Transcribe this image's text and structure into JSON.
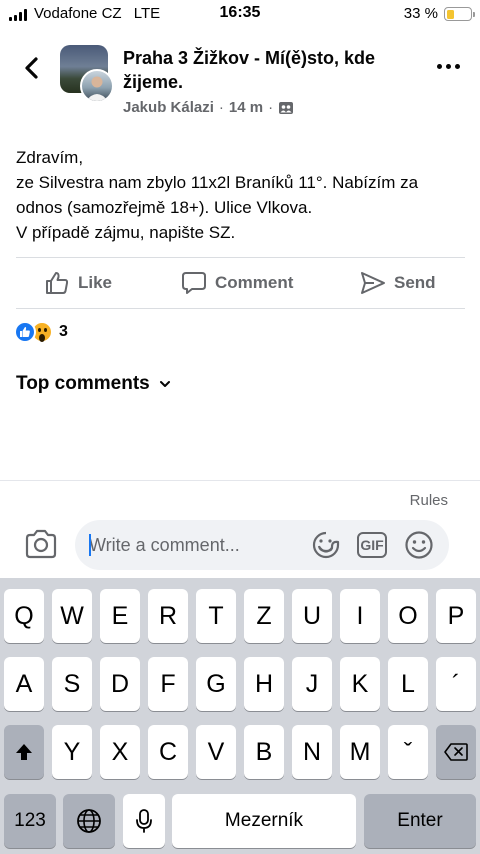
{
  "status_bar": {
    "carrier": "Vodafone CZ",
    "network": "LTE",
    "time": "16:35",
    "battery_percent": "33 %",
    "battery_level": 0.33,
    "battery_color": "#f4c430"
  },
  "header": {
    "back_icon": "chevron-left-icon",
    "group_name": "Praha 3 Žižkov - Mí(ě)sto, kde žijeme.",
    "author": "Jakub Kálazi",
    "separator": "·",
    "time_ago": "14 m",
    "audience_icon": "group-audience-icon",
    "more_icon": "more-horizontal-icon"
  },
  "post": {
    "lines": [
      "Zdravím,",
      "ze Silvestra nam zbylo 11x2l Braníků 11°. Nabízím za odnos (samozřejmě 18+). Ulice Vlkova.",
      "V případě zájmu, napište SZ."
    ]
  },
  "actions": {
    "like": "Like",
    "comment": "Comment",
    "send": "Send"
  },
  "reactions": {
    "types": [
      "like",
      "wow"
    ],
    "count": "3",
    "like_color": "#1877f2",
    "wow_color": "#f7b125"
  },
  "comments": {
    "sort_label": "Top comments",
    "rules": "Rules",
    "input_placeholder": "Write a comment...",
    "gif_label": "GIF"
  },
  "keyboard": {
    "row1": [
      "Q",
      "W",
      "E",
      "R",
      "T",
      "Z",
      "U",
      "I",
      "O",
      "P"
    ],
    "row2": [
      "A",
      "S",
      "D",
      "F",
      "G",
      "H",
      "J",
      "K",
      "L",
      "´"
    ],
    "row3": [
      "Y",
      "X",
      "C",
      "V",
      "B",
      "N",
      "M",
      "ˇ"
    ],
    "numbers_key": "123",
    "space_key": "Mezerník",
    "return_key": "Enter"
  }
}
